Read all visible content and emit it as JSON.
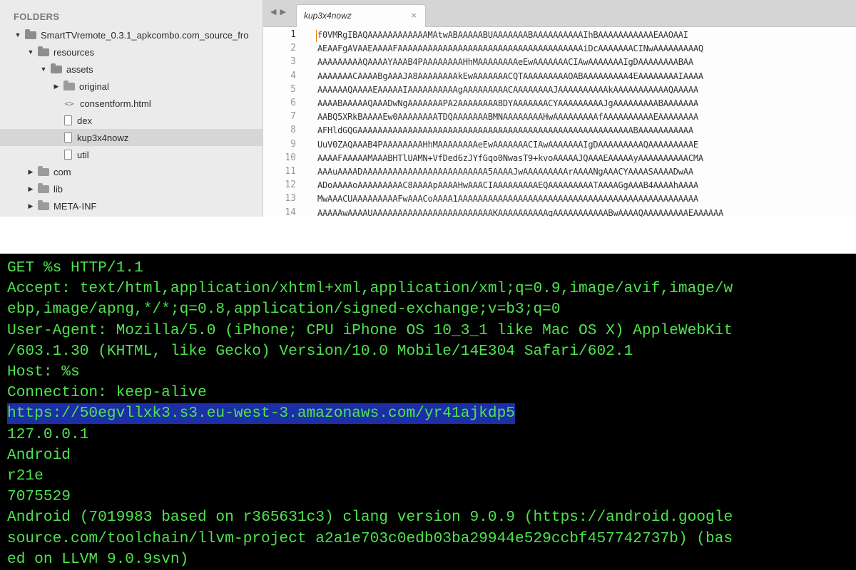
{
  "sidebar": {
    "header": "FOLDERS",
    "items": [
      {
        "label": "SmartTVremote_0.3.1_apkcombo.com_source_fro",
        "kind": "folder",
        "icon": "folder-open-icon"
      },
      {
        "label": "resources",
        "kind": "folder",
        "icon": "folder-open-icon"
      },
      {
        "label": "assets",
        "kind": "folder",
        "icon": "folder-open-icon"
      },
      {
        "label": "original",
        "kind": "folder",
        "icon": "folder-icon"
      },
      {
        "label": "consentform.html",
        "kind": "file",
        "icon": "code-file-icon"
      },
      {
        "label": "dex",
        "kind": "file",
        "icon": "file-icon"
      },
      {
        "label": "kup3x4nowz",
        "kind": "file",
        "icon": "file-icon",
        "selected": true
      },
      {
        "label": "util",
        "kind": "file",
        "icon": "file-icon"
      },
      {
        "label": "com",
        "kind": "folder",
        "icon": "folder-icon"
      },
      {
        "label": "lib",
        "kind": "folder",
        "icon": "folder-icon"
      },
      {
        "label": "META-INF",
        "kind": "folder",
        "icon": "folder-icon"
      }
    ]
  },
  "editor": {
    "nav_arrows": "◀ ▶",
    "tab": {
      "title": "kup3x4nowz",
      "close": "×"
    },
    "lines": [
      {
        "no": "1",
        "text": "f0VMRgIBAQAAAAAAAAAAAAMAtwABAAAAABUAAAAAAABAAAAAAAAAAIhBAAAAAAAAAAAEAAOAAI"
      },
      {
        "no": "2",
        "text": "AEAAFgAVAAEAAAAFAAAAAAAAAAAAAAAAAAAAAAAAAAAAAAAAAAAAAiDcAAAAAAACINwAAAAAAAAAQ"
      },
      {
        "no": "3",
        "text": "AAAAAAAAAQAAAAYAAAB4PAAAAAAAAHhMAAAAAAAAeEwAAAAAAACIAwAAAAAAAIgDAAAAAAAABAA"
      },
      {
        "no": "4",
        "text": "AAAAAAACAAAABgAAAJA8AAAAAAAAkEwAAAAAAACQTAAAAAAAAAOABAAAAAAAAA4EAAAAAAAAIAAAA"
      },
      {
        "no": "5",
        "text": "AAAAAAQAAAAEAAAAAIAAAAAAAAAAgAAAAAAAAACAAAAAAAAJAAAAAAAAAAkAAAAAAAAAAAQAAAAA"
      },
      {
        "no": "6",
        "text": "AAAABAAAAAQAAADwNgAAAAAAAPA2AAAAAAAA8DYAAAAAAACYAAAAAAAAAJgAAAAAAAAABAAAAAAA"
      },
      {
        "no": "7",
        "text": "AABQ5XRkBAAAAEw0AAAAAAAATDQAAAAAAABMNAAAAAAAAHwAAAAAAAAAfAAAAAAAAAAEAAAAAAAA"
      },
      {
        "no": "8",
        "text": "AFHldGQGAAAAAAAAAAAAAAAAAAAAAAAAAAAAAAAAAAAAAAAAAAAAAAAAAAAAAAABAAAAAAAAAAA"
      },
      {
        "no": "9",
        "text": "UuV0ZAQAAAB4PAAAAAAAAHhMAAAAAAAAeEwAAAAAAACIAwAAAAAAAIgDAAAAAAAAAQAAAAAAAAAE"
      },
      {
        "no": "10",
        "text": "AAAAFAAAAAMAAABHTlUAMN+VfDed6zJYfGqo0NwasT9+kvoAAAAAJQAAAEAAAAAyAAAAAAAAAACMA"
      },
      {
        "no": "11",
        "text": "AAAuAAAADAAAAAAAAAAAAAAAAAAAAAAAAA5AAAAJwAAAAAAAAArAAAANgAAACYAAAASAAAADwAA"
      },
      {
        "no": "12",
        "text": "ADoAAAAoAAAAAAAAAC8AAAApAAAAHwAAACIAAAAAAAAAEQAAAAAAAAATAAAAGgAAAB4AAAAhAAAA"
      },
      {
        "no": "13",
        "text": "MwAAACUAAAAAAAAAFwAAACoAAAA1AAAAAAAAAAAAAAAAAAAAAAAAAAAAAAAAAAAAAAAAAAAAAAAA"
      },
      {
        "no": "14",
        "text": "AAAAAwAAAAUAAAAAAAAAAAAAAAAAAAAAAAAKAAAAAAAAAAgAAAAAAAAAAABwAAAAQAAAAAAAAAEAAAAAA"
      }
    ]
  },
  "terminal": {
    "lines": [
      {
        "text": "GET %s HTTP/1.1",
        "highlight": false
      },
      {
        "text": "Accept: text/html,application/xhtml+xml,application/xml;q=0.9,image/avif,image/w",
        "highlight": false
      },
      {
        "text": "ebp,image/apng,*/*;q=0.8,application/signed-exchange;v=b3;q=0",
        "highlight": false
      },
      {
        "text": "User-Agent: Mozilla/5.0 (iPhone; CPU iPhone OS 10_3_1 like Mac OS X) AppleWebKit",
        "highlight": false
      },
      {
        "text": "/603.1.30 (KHTML, like Gecko) Version/10.0 Mobile/14E304 Safari/602.1",
        "highlight": false
      },
      {
        "text": "Host: %s",
        "highlight": false
      },
      {
        "text": "Connection: keep-alive",
        "highlight": false
      },
      {
        "text": "https://50egvllxk3.s3.eu-west-3.amazonaws.com/yr41ajkdp5",
        "highlight": true
      },
      {
        "text": "127.0.0.1",
        "highlight": false
      },
      {
        "text": "Android",
        "highlight": false
      },
      {
        "text": "r21e",
        "highlight": false
      },
      {
        "text": "7075529",
        "highlight": false
      },
      {
        "text": "Android (7019983 based on r365631c3) clang version 9.0.9 (https://android.google",
        "highlight": false
      },
      {
        "text": "source.com/toolchain/llvm-project a2a1e703c0edb03ba29944e529ccbf457742737b) (bas",
        "highlight": false
      },
      {
        "text": "ed on LLVM 9.0.9svn)",
        "highlight": false
      }
    ]
  }
}
